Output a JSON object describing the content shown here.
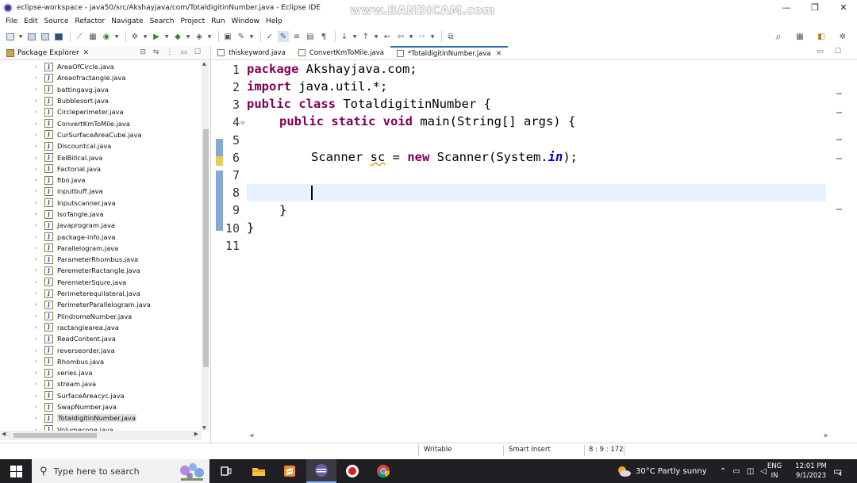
{
  "window": {
    "title": "eclipse-workspace - java50/src/Akshayjava/com/TotaldigitinNumber.java - Eclipse IDE",
    "watermark": "www.BANDICAM.com",
    "minimize": "—",
    "maximize": "❐",
    "close": "✕"
  },
  "menu": [
    "File",
    "Edit",
    "Source",
    "Refactor",
    "Navigate",
    "Search",
    "Project",
    "Run",
    "Window",
    "Help"
  ],
  "package_explorer": {
    "title": "Package Explorer",
    "files": [
      "AreaOfCircle.java",
      "Areaofractangle.java",
      "battingavg.java",
      "Bubblesort.java",
      "Circleperimeter.java",
      "ConvertKmToMile.java",
      "CurSurfaceAreaCube.java",
      "Discountcal.java",
      "EelBillcal.java",
      "Factorial.java",
      "fibo.java",
      "inputbuff.java",
      "Inputscanner.java",
      "IsoTangle.java",
      "Javaprogram.java",
      "package-info.java",
      "Parallelogram.java",
      "ParameterRhombus.java",
      "PeremeterRactangle.java",
      "PeremeterSqure.java",
      "Perimeterequilateral.java",
      "PerimeterParallelogram.java",
      "PlindromeNumber.java",
      "ractanglearea.java",
      "ReadContent.java",
      "reverseorder.java",
      "Rhombus.java",
      "series.java",
      "stream.java",
      "SurfaceAreacyc.java",
      "SwapNumber.java",
      "TotaldigitinNumber.java",
      "Volumecone.java"
    ],
    "selected": "TotaldigitinNumber.java"
  },
  "editor": {
    "tabs": [
      {
        "label": "thiskeyword.java",
        "active": false
      },
      {
        "label": "ConvertKmToMile.java",
        "active": false
      },
      {
        "label": "*TotaldigitinNumber.java",
        "active": true
      }
    ],
    "line_numbers": [
      "1",
      "2",
      "3",
      "4",
      "5",
      "6",
      "7",
      "8",
      "9",
      "10",
      "11"
    ],
    "code": {
      "l1_kw": "package",
      "l1_rest": " Akshayjava.com;",
      "l2_kw": "import",
      "l2_rest": " java.util.*;",
      "l3_kw": "public class",
      "l3_rest": " TotaldigitinNumber {",
      "l4_kw": "public static void",
      "l4_rest": " main(String[] args) {",
      "l6_a": "Scanner ",
      "l6_var": "sc",
      "l6_b": " = ",
      "l6_kw": "new",
      "l6_c": " Scanner(System.",
      "l6_fld": "in",
      "l6_d": ");",
      "l9": "}",
      "l10": "}"
    },
    "current_line": 8
  },
  "status": {
    "mode": "Writable",
    "insert": "Smart Insert",
    "position": "8 : 9 : 172"
  },
  "taskbar": {
    "search_placeholder": "Type here to search",
    "weather": "30°C  Partly sunny",
    "lang_top": "ENG",
    "lang_bottom": "IN",
    "time": "12:01 PM",
    "date": "9/1/2023",
    "notifications": "4"
  }
}
